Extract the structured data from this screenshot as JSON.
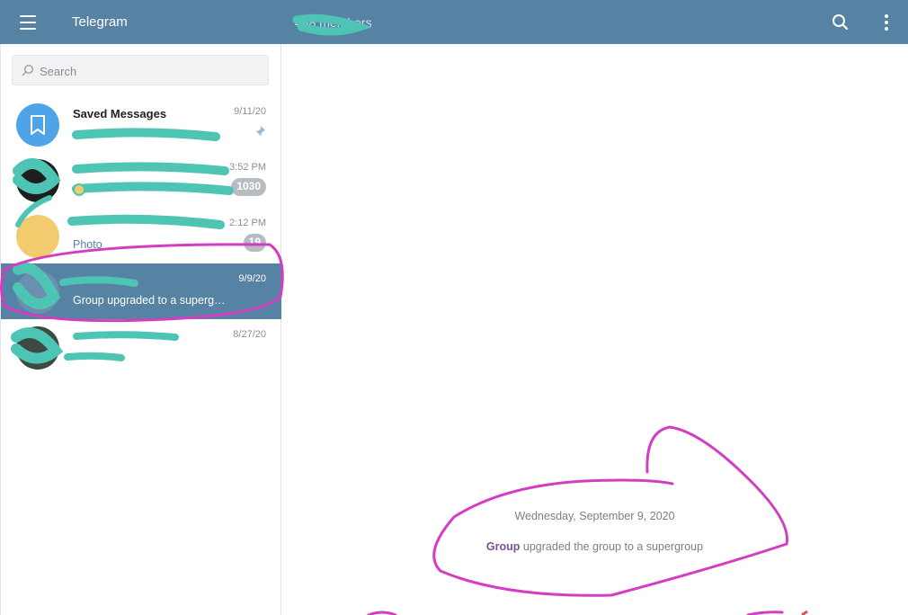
{
  "header": {
    "app_title": "Telegram",
    "chat_title": "488 members",
    "menu_icon": "hamburger-menu-icon",
    "search_icon": "search-icon",
    "more_icon": "more-vertical-icon",
    "bg_color": "#5682a3"
  },
  "search": {
    "placeholder": "Search"
  },
  "chats": [
    {
      "name": "Saved Messages",
      "time": "9/11/20",
      "preview": "",
      "pinned": true
    },
    {
      "name": "",
      "time": "3:52 PM",
      "preview": "",
      "badge": "1030"
    },
    {
      "name": "",
      "time": "2:12 PM",
      "preview": "Photo",
      "badge": "19"
    },
    {
      "name": "",
      "time": "9/9/20",
      "preview": "Group upgraded to a superg…",
      "active": true
    },
    {
      "name": "",
      "time": "8/27/20",
      "preview": ""
    }
  ],
  "conversation": {
    "date_separator": "Wednesday, September 9, 2020",
    "service_actor": "Group",
    "service_text": " upgraded the group to a supergroup"
  },
  "colors": {
    "accent": "#5682a3",
    "scribble_teal": "#4dc4b4",
    "scribble_magenta": "#d43cc2"
  }
}
